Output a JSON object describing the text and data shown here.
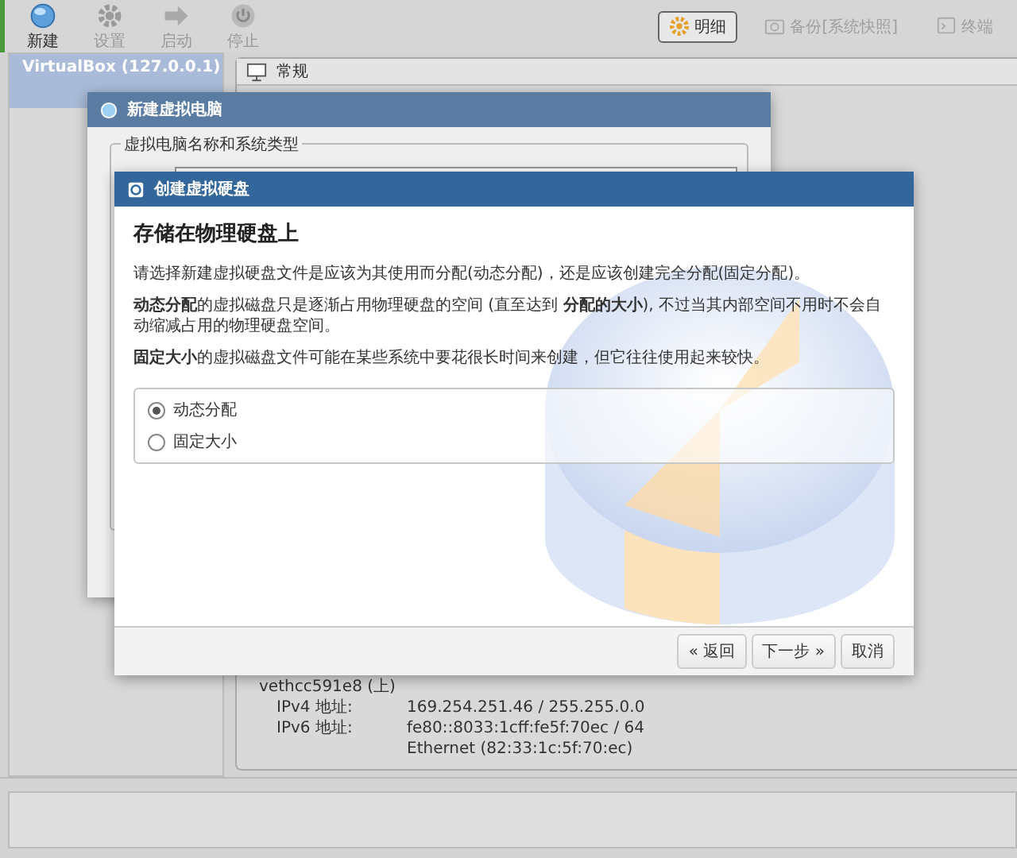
{
  "toolbar": {
    "left": [
      {
        "label": "新建",
        "disabled": false
      },
      {
        "label": "设置",
        "disabled": true
      },
      {
        "label": "启动",
        "disabled": true
      },
      {
        "label": "停止",
        "disabled": true
      }
    ],
    "right": [
      {
        "label": "明细",
        "selected": true,
        "disabled": false
      },
      {
        "label": "备份[系统快照]",
        "selected": false,
        "disabled": true
      },
      {
        "label": "终端",
        "selected": false,
        "disabled": true
      }
    ]
  },
  "sidebar": {
    "items": [
      {
        "name": "VirtualBox (127.0.0.1)",
        "selected": true
      }
    ]
  },
  "details": {
    "section": "常规",
    "network": {
      "interface": "vethcc591e8 (上)",
      "rows": [
        {
          "label": "IPv4 地址:",
          "value": "169.254.251.46 / 255.255.0.0"
        },
        {
          "label": "IPv6 地址:",
          "value": "fe80::8033:1cff:fe5f:70ec / 64"
        },
        {
          "value": "Ethernet (82:33:1c:5f:70:ec)"
        }
      ]
    }
  },
  "back_dialog": {
    "title": "新建虚拟电脑",
    "group": "虚拟电脑名称和系统类型"
  },
  "dialog": {
    "title": "创建虚拟硬盘",
    "heading": "存储在物理硬盘上",
    "paragraphs": [
      "请选择新建虚拟硬盘文件是应该为其使用而分配(动态分配)，还是应该创建完全分配(固定分配)。",
      "**动态分配**的虚拟磁盘只是逐渐占用物理硬盘的空间 (直至达到 **分配的大小**), 不过当其内部空间不用时不会自动缩减占用的物理硬盘空间。",
      "**固定大小**的虚拟磁盘文件可能在某些系统中要花很长时间来创建，但它往往使用起来较快。"
    ],
    "options": [
      {
        "label": "动态分配",
        "selected": true
      },
      {
        "label": "固定大小",
        "selected": false
      }
    ],
    "buttons": [
      {
        "label": "« 返回"
      },
      {
        "label": "下一步 »"
      },
      {
        "label": "取消"
      }
    ]
  }
}
